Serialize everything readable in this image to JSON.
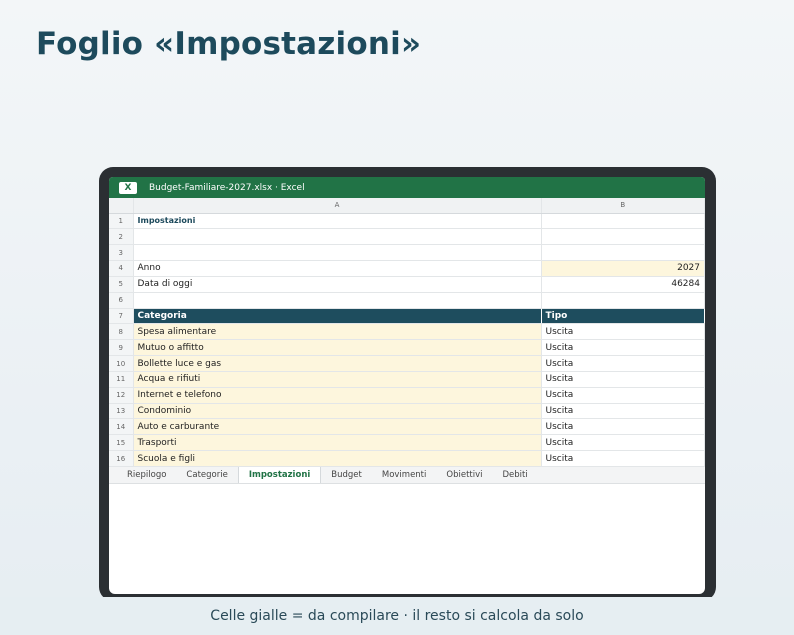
{
  "page": {
    "title": "Foglio «Impostazioni»"
  },
  "window": {
    "app_icon_letter": "X",
    "title": "Budget-Familiare-2027.xlsx · Excel"
  },
  "sheet": {
    "columns": [
      "A",
      "B"
    ],
    "rows": [
      {
        "num": "1",
        "a": "Impostazioni",
        "b": ""
      },
      {
        "num": "2",
        "a": "",
        "b": ""
      },
      {
        "num": "3",
        "a": "",
        "b": ""
      },
      {
        "num": "4",
        "a": "Anno",
        "b": "2027"
      },
      {
        "num": "5",
        "a": "Data di oggi",
        "b": "46284"
      },
      {
        "num": "6",
        "a": "",
        "b": ""
      },
      {
        "num": "7",
        "a": "Categoria",
        "b": "Tipo"
      },
      {
        "num": "8",
        "a": "Spesa alimentare",
        "b": "Uscita"
      },
      {
        "num": "9",
        "a": "Mutuo o affitto",
        "b": "Uscita"
      },
      {
        "num": "10",
        "a": "Bollette luce e gas",
        "b": "Uscita"
      },
      {
        "num": "11",
        "a": "Acqua e rifiuti",
        "b": "Uscita"
      },
      {
        "num": "12",
        "a": "Internet e telefono",
        "b": "Uscita"
      },
      {
        "num": "13",
        "a": "Condominio",
        "b": "Uscita"
      },
      {
        "num": "14",
        "a": "Auto e carburante",
        "b": "Uscita"
      },
      {
        "num": "15",
        "a": "Trasporti",
        "b": "Uscita"
      },
      {
        "num": "16",
        "a": "Scuola e figli",
        "b": "Uscita"
      }
    ]
  },
  "tabs": [
    {
      "label": "Riepilogo",
      "active": false
    },
    {
      "label": "Categorie",
      "active": false
    },
    {
      "label": "Impostazioni",
      "active": true
    },
    {
      "label": "Budget",
      "active": false
    },
    {
      "label": "Movimenti",
      "active": false
    },
    {
      "label": "Obiettivi",
      "active": false
    },
    {
      "label": "Debiti",
      "active": false
    }
  ],
  "footer": {
    "text": "Celle gialle = da compilare · il resto si calcola da solo"
  },
  "colors": {
    "excel_green": "#217346",
    "header_teal": "#1e4d5e",
    "input_yellow": "#fdf6dd",
    "title": "#1d4a5c"
  }
}
